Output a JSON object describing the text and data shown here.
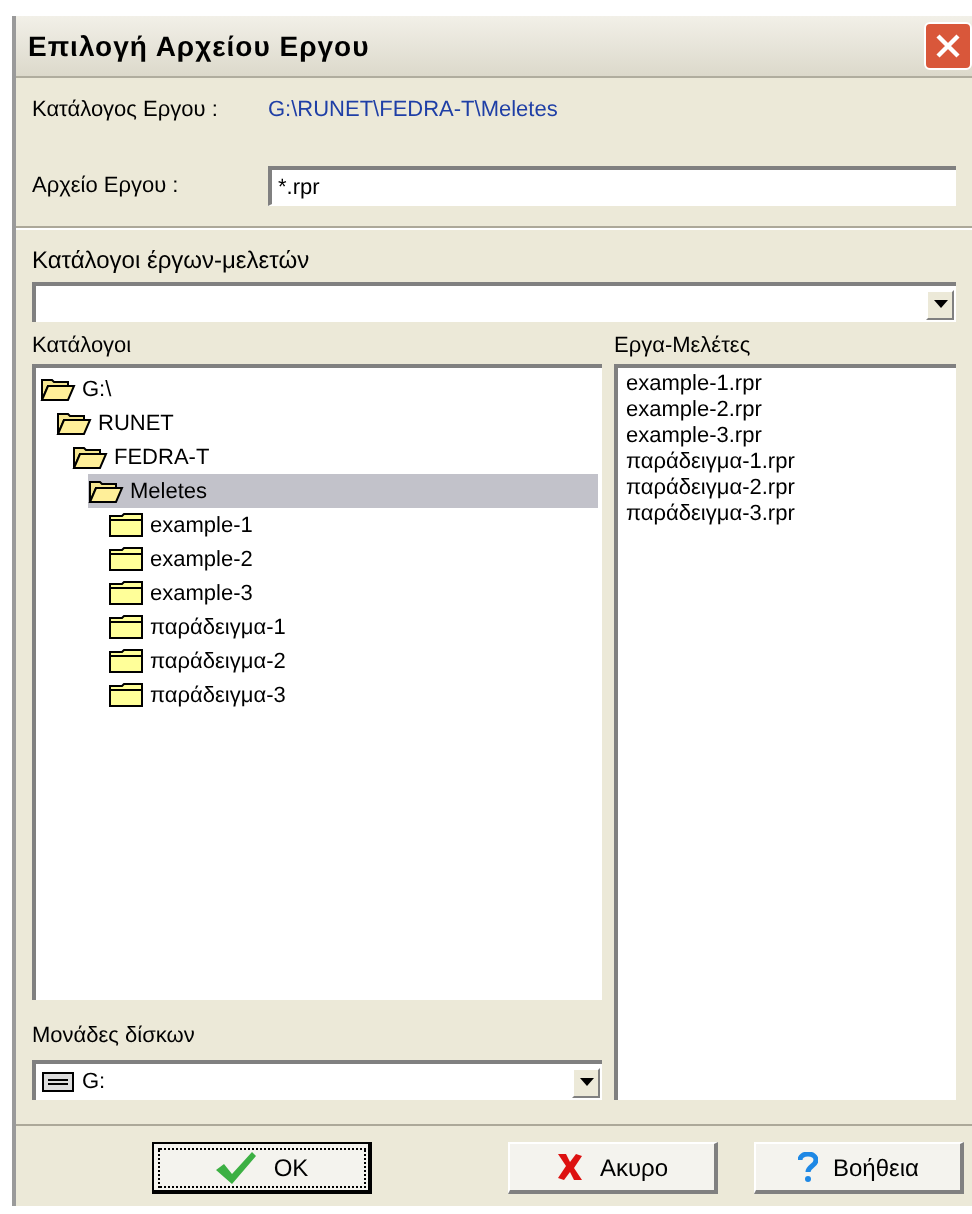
{
  "window": {
    "title": "Επιλογή Αρχείου Εργου"
  },
  "project_folder": {
    "label": "Κατάλογος Εργου :",
    "value": "G:\\RUNET\\FEDRA-T\\Meletes"
  },
  "project_file": {
    "label": "Αρχείο Εργου :",
    "value": "*.rpr"
  },
  "project_dirs": {
    "label": "Κατάλογοι έργων-μελετών"
  },
  "folders": {
    "label": "Κατάλογοι",
    "tree": [
      {
        "name": "G:\\",
        "expanded": true,
        "selected": false,
        "children": [
          {
            "name": "RUNET",
            "expanded": true,
            "selected": false,
            "children": [
              {
                "name": "FEDRA-T",
                "expanded": true,
                "selected": false,
                "children": [
                  {
                    "name": "Meletes",
                    "expanded": true,
                    "selected": true,
                    "children": [
                      {
                        "name": "example-1",
                        "expanded": false,
                        "selected": false
                      },
                      {
                        "name": "example-2",
                        "expanded": false,
                        "selected": false
                      },
                      {
                        "name": "example-3",
                        "expanded": false,
                        "selected": false
                      },
                      {
                        "name": "παράδειγμα-1",
                        "expanded": false,
                        "selected": false
                      },
                      {
                        "name": "παράδειγμα-2",
                        "expanded": false,
                        "selected": false
                      },
                      {
                        "name": "παράδειγμα-3",
                        "expanded": false,
                        "selected": false
                      }
                    ]
                  }
                ]
              }
            ]
          }
        ]
      }
    ]
  },
  "files": {
    "label": "Εργα-Μελέτες",
    "items": [
      "example-1.rpr",
      "example-2.rpr",
      "example-3.rpr",
      "παράδειγμα-1.rpr",
      "παράδειγμα-2.rpr",
      "παράδειγμα-3.rpr"
    ]
  },
  "drives": {
    "label": "Μονάδες δίσκων",
    "value": "G:"
  },
  "buttons": [
    {
      "kind": "ok",
      "label": "OK"
    },
    {
      "kind": "cancel",
      "label": "Ακυρο"
    },
    {
      "kind": "help",
      "label": "Βοήθεια"
    }
  ]
}
